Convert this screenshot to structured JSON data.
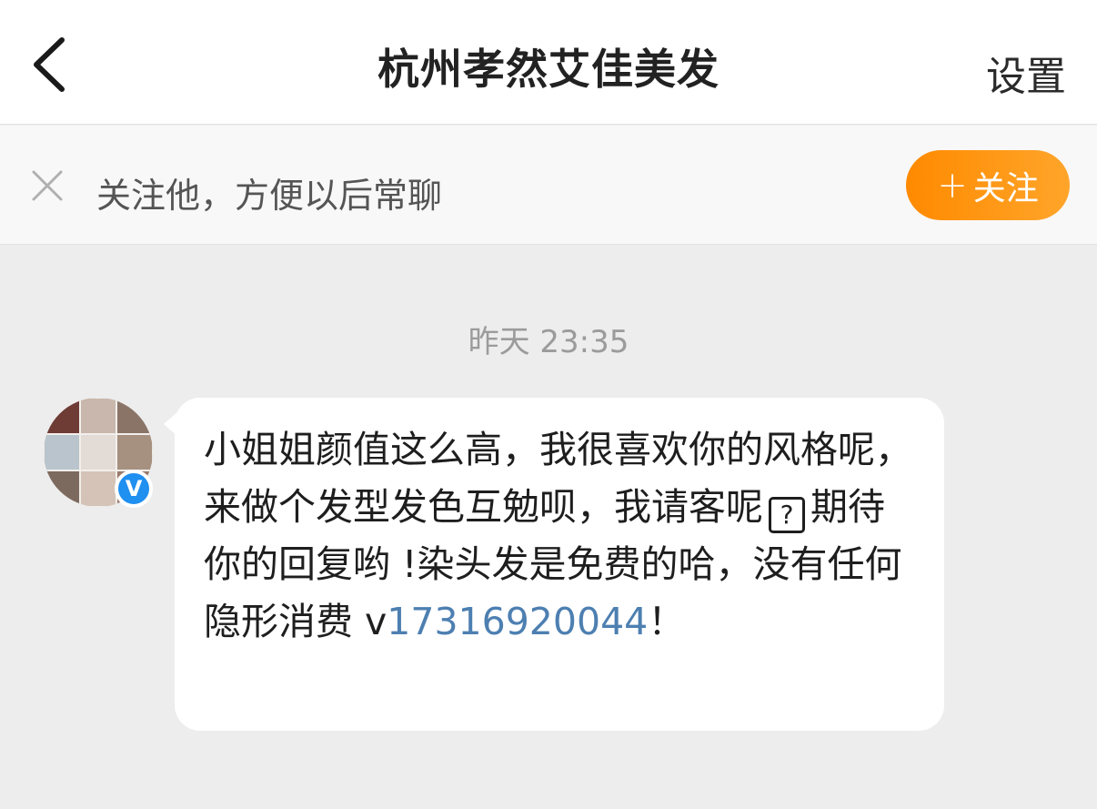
{
  "nav": {
    "title": "杭州孝然艾佳美发",
    "settings_label": "设置"
  },
  "follow_bar": {
    "hint": "关注他，方便以后常聊",
    "follow_plus": "+",
    "follow_label": "关注"
  },
  "chat": {
    "timestamp": "昨天 23:35",
    "message": {
      "part1": "小姐姐颜值这么高，我很喜欢你的风格呢，来做个发型发色互勉呗，我请客呢",
      "qmark": "?",
      "part2": "期待你的回复哟 !染头发是免费的哈，没有任何隐形消费 v",
      "phone": "17316920044",
      "part3": "！"
    },
    "verified_badge": "V"
  },
  "colors": {
    "accent_orange": "#ff8a00",
    "link_blue": "#4d7fb1",
    "verified_blue": "#1f8ff0"
  }
}
